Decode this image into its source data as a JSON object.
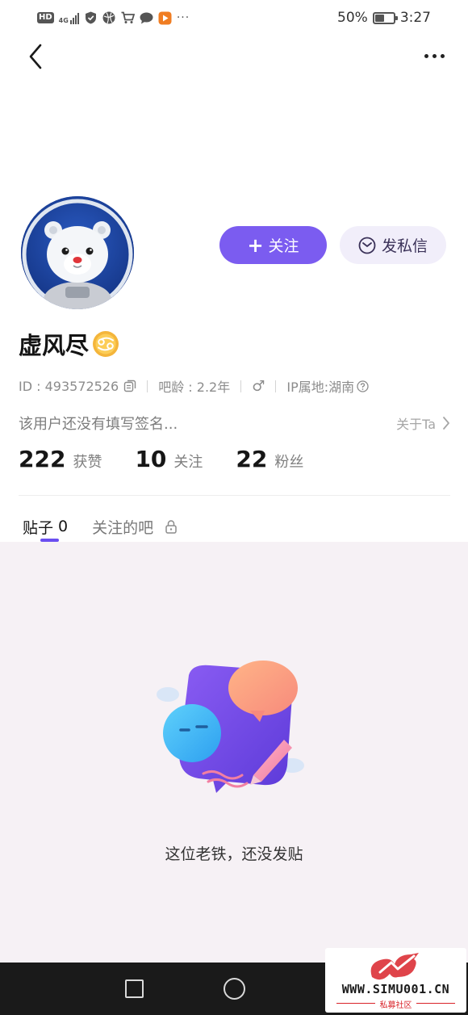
{
  "status_bar": {
    "hd_badge": "HD",
    "network": "4G",
    "more": "···",
    "battery_text": "50%",
    "battery_level": 0.5,
    "time": "3:27"
  },
  "header": {
    "back_icon": "chevron-left-icon",
    "more_icon": "more-horizontal-icon"
  },
  "profile": {
    "avatar_icon": "astronaut-polar-bear-avatar",
    "nickname": "虚风尽",
    "zodiac_icon": "cancer-zodiac-icon",
    "follow_plus": "+",
    "follow_label": "关注",
    "message_label": "发私信",
    "id_text": "ID : 493572526",
    "bar_age_text": "吧龄 : 2.2年",
    "gender_symbol": "♂",
    "ip_text": "IP属地:湖南",
    "signature": "该用户还没有填写签名...",
    "about_label": "关于Ta"
  },
  "stats": [
    {
      "value": "222",
      "label": "获赞"
    },
    {
      "value": "10",
      "label": "关注"
    },
    {
      "value": "22",
      "label": "粉丝"
    }
  ],
  "tabs": [
    {
      "label": "贴子",
      "count": "0"
    },
    {
      "label": "关注的吧"
    }
  ],
  "empty_state": {
    "illustration": "empty-posts-illustration",
    "text": "这位老铁，还没发贴"
  },
  "watermark": {
    "url": "WWW.SIMU001.CN",
    "subtitle": "私募社区"
  },
  "colors": {
    "accent": "#7b5cf0",
    "tab_indicator": "#6a4ef0",
    "content_bg": "#f6f1f5",
    "message_btn_bg": "#f1eefa",
    "nav_bar": "#1a1a1a"
  }
}
